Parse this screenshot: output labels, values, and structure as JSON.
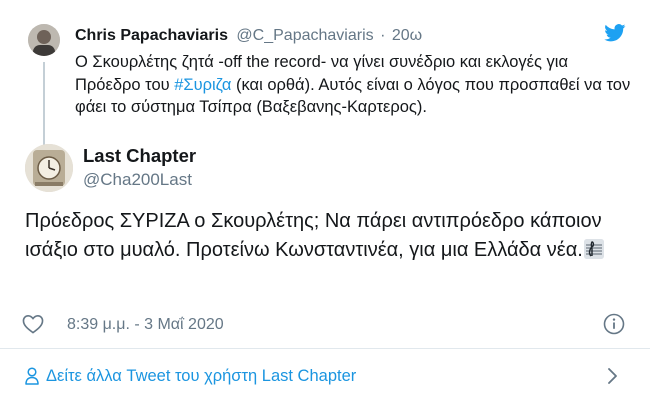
{
  "parent_tweet": {
    "author_name": "Chris Papachaviaris",
    "author_handle": "@C_Papachaviaris",
    "separator": "·",
    "time_ago": "20ω",
    "text_before": "Ο Σκουρλέτης ζητά -off the record- να γίνει συνέδριο και εκλογές για Πρόεδρο του ",
    "hashtag": "#Συριζα",
    "text_after": " (και ορθά). Αυτός είναι ο λόγος που προσπαθεί να τον φάει το σύστημα Τσίπρα (Βαξεβανης-Καρτερος)."
  },
  "main_tweet": {
    "author_name": "Last Chapter",
    "author_handle": "@Cha200Last",
    "text": "Πρόεδρος ΣΥΡΙΖΑ ο Σκουρλέτης; Να πάρει αντιπρόεδρο κάποιον ισάξιο στο μυαλό. Προτείνω Κωνσταντινέα, για μια Ελλάδα νέα.",
    "emoji": "music-score-emoji",
    "timestamp": "8:39 μ.μ. - 3 Μαΐ 2020"
  },
  "footer": {
    "see_more_label": "Δείτε άλλα Tweet του χρήστη Last Chapter"
  },
  "colors": {
    "text": "#14171a",
    "secondary": "#657786",
    "link": "#1b95e0",
    "twitter_blue": "#1da1f2",
    "divider": "#e1e8ed"
  },
  "icons": [
    "twitter-logo-icon",
    "like-heart-icon",
    "info-icon",
    "user-icon",
    "chevron-right-icon"
  ]
}
